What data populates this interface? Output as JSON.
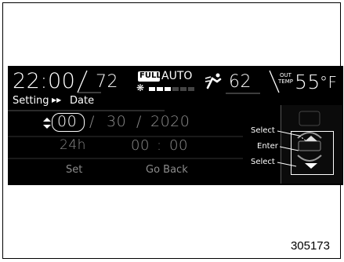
{
  "status_bar": {
    "time": "22:00",
    "temp_left": "72",
    "full_label": "FULL",
    "auto_label": "AUTO",
    "fan_level": 3,
    "fan_max": 8,
    "vent_icon": "airflow-icon",
    "temp_right": "62",
    "out_label_line1": "OUT",
    "out_label_line2": "TEMP",
    "outside_temp": "55",
    "unit": "°F"
  },
  "breadcrumb": {
    "part1": "Setting",
    "separator_icon": "double-right-arrow-icon",
    "part2": "Date"
  },
  "date_row": {
    "month": "00",
    "sep1": "/",
    "day": "30",
    "sep2": "/",
    "year": "2020"
  },
  "time_row": {
    "format": "24h",
    "hour": "00",
    "colon": ":",
    "minute": "00"
  },
  "buttons": {
    "set": "Set",
    "go_back": "Go Back"
  },
  "callouts": {
    "select_top": "Select",
    "enter": "Enter",
    "select_bottom": "Select"
  },
  "figure_number": "305173"
}
